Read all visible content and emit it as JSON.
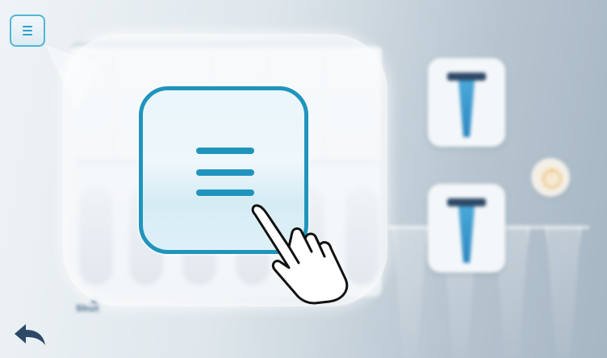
{
  "app": {
    "menu_button": {
      "icon": "hamburger-menu-icon"
    },
    "back_button": {
      "icon": "back-arrow-icon"
    },
    "background": {
      "small_label": "Shut",
      "tube_cards": [
        "tube-icon",
        "tube-icon"
      ],
      "rotate_button": {
        "icon": "rotate-icon"
      }
    },
    "tutorial": {
      "highlighted_button": {
        "icon": "hamburger-menu-icon"
      },
      "pointer": {
        "icon": "pointing-hand-icon"
      }
    },
    "colors": {
      "accent": "#1f95bd",
      "tube_blue": "#2c86c1",
      "tube_cap": "#2d4867",
      "back_arrow": "#2d4867"
    }
  }
}
